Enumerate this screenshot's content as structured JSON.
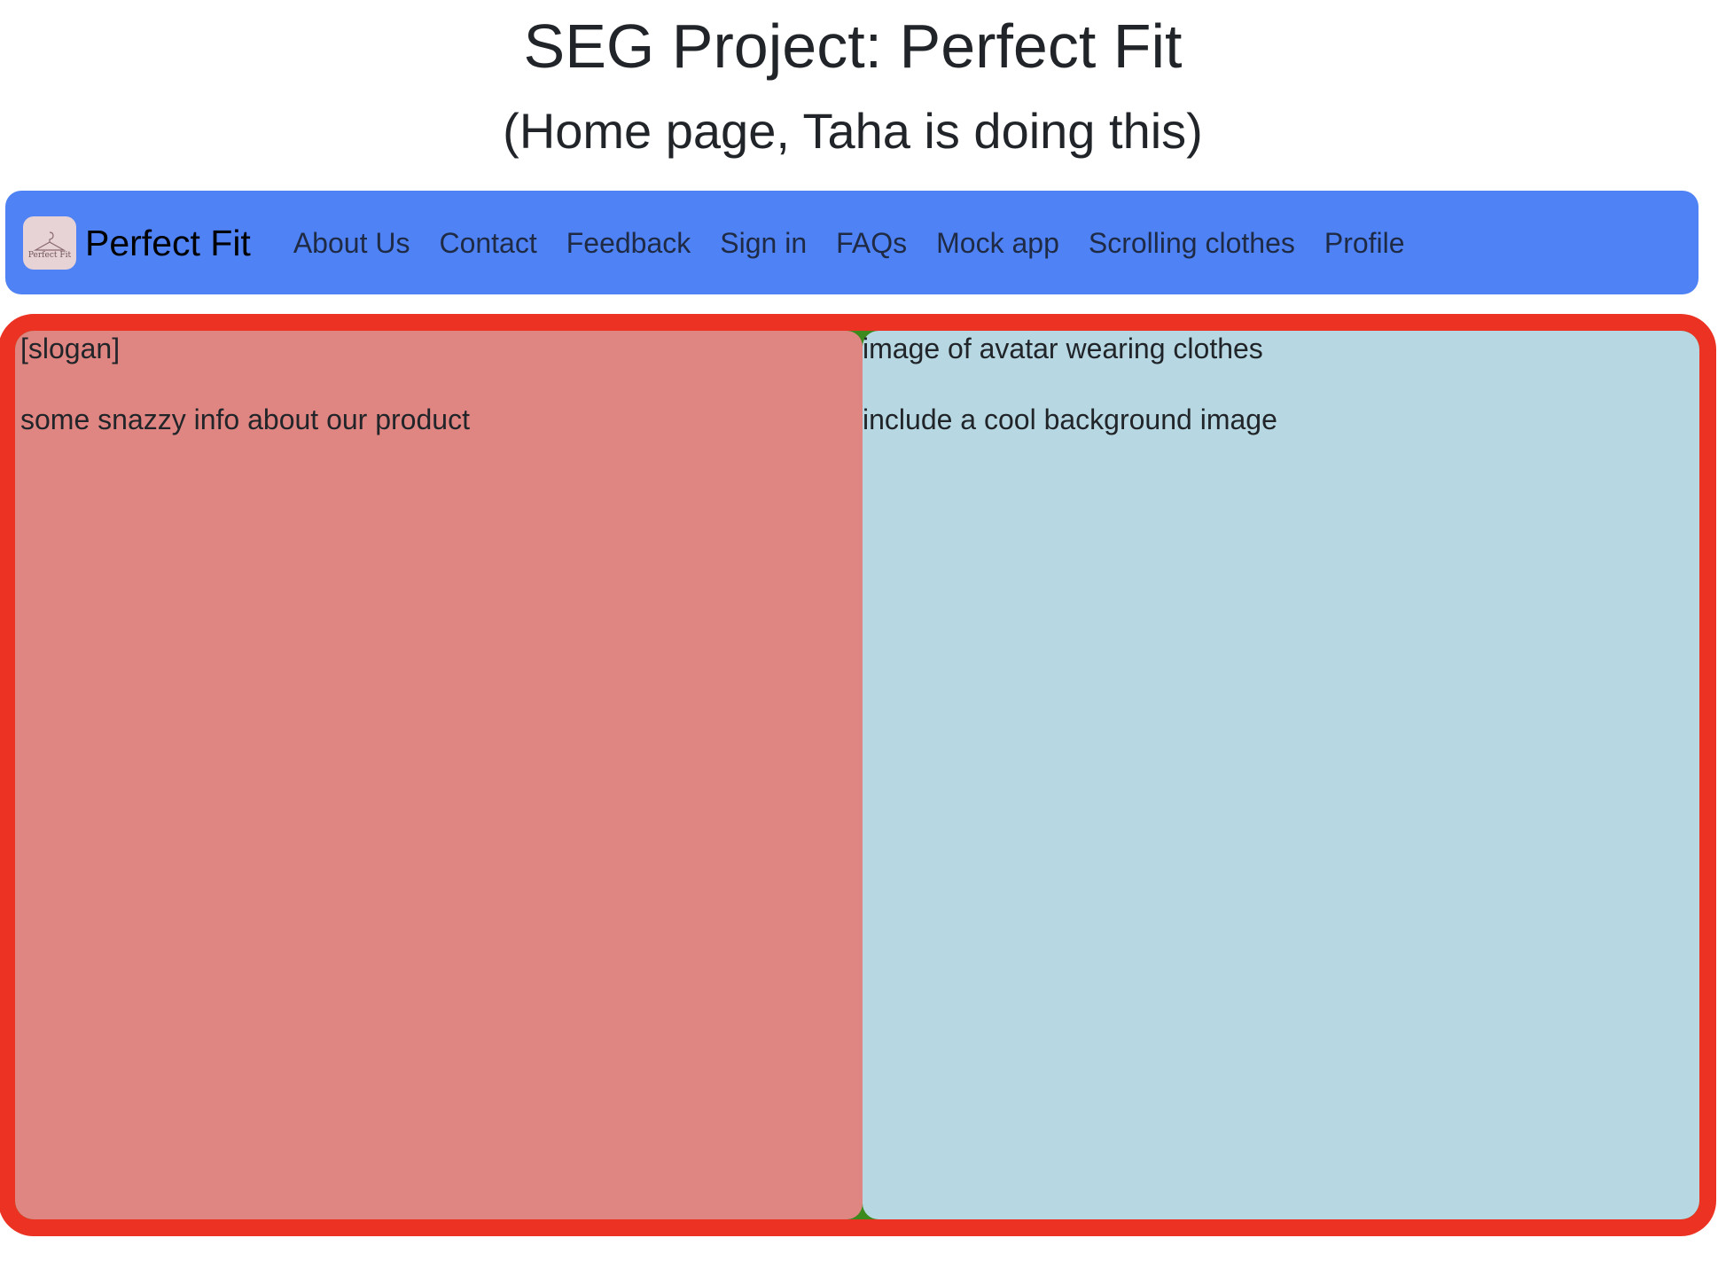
{
  "page": {
    "title": "SEG Project: Perfect Fit",
    "subtitle": "(Home page, Taha is doing this)"
  },
  "navbar": {
    "logo_text": "Perfect Fit",
    "brand": "Perfect Fit",
    "links": [
      {
        "label": "About Us"
      },
      {
        "label": "Contact"
      },
      {
        "label": "Feedback"
      },
      {
        "label": "Sign in"
      },
      {
        "label": "FAQs"
      },
      {
        "label": "Mock app"
      },
      {
        "label": "Scrolling clothes"
      },
      {
        "label": "Profile"
      }
    ]
  },
  "hero": {
    "left": {
      "slogan": "[slogan]",
      "info": "some snazzy info about our product"
    },
    "right": {
      "line1": "image of avatar wearing clothes",
      "line2": "include a cool background image"
    }
  },
  "colors": {
    "navbar": "#4f82f5",
    "hero_border": "#ec3323",
    "left_panel": "#e08682",
    "right_panel": "#b7d8e3",
    "gutter": "#3c8a1e"
  }
}
